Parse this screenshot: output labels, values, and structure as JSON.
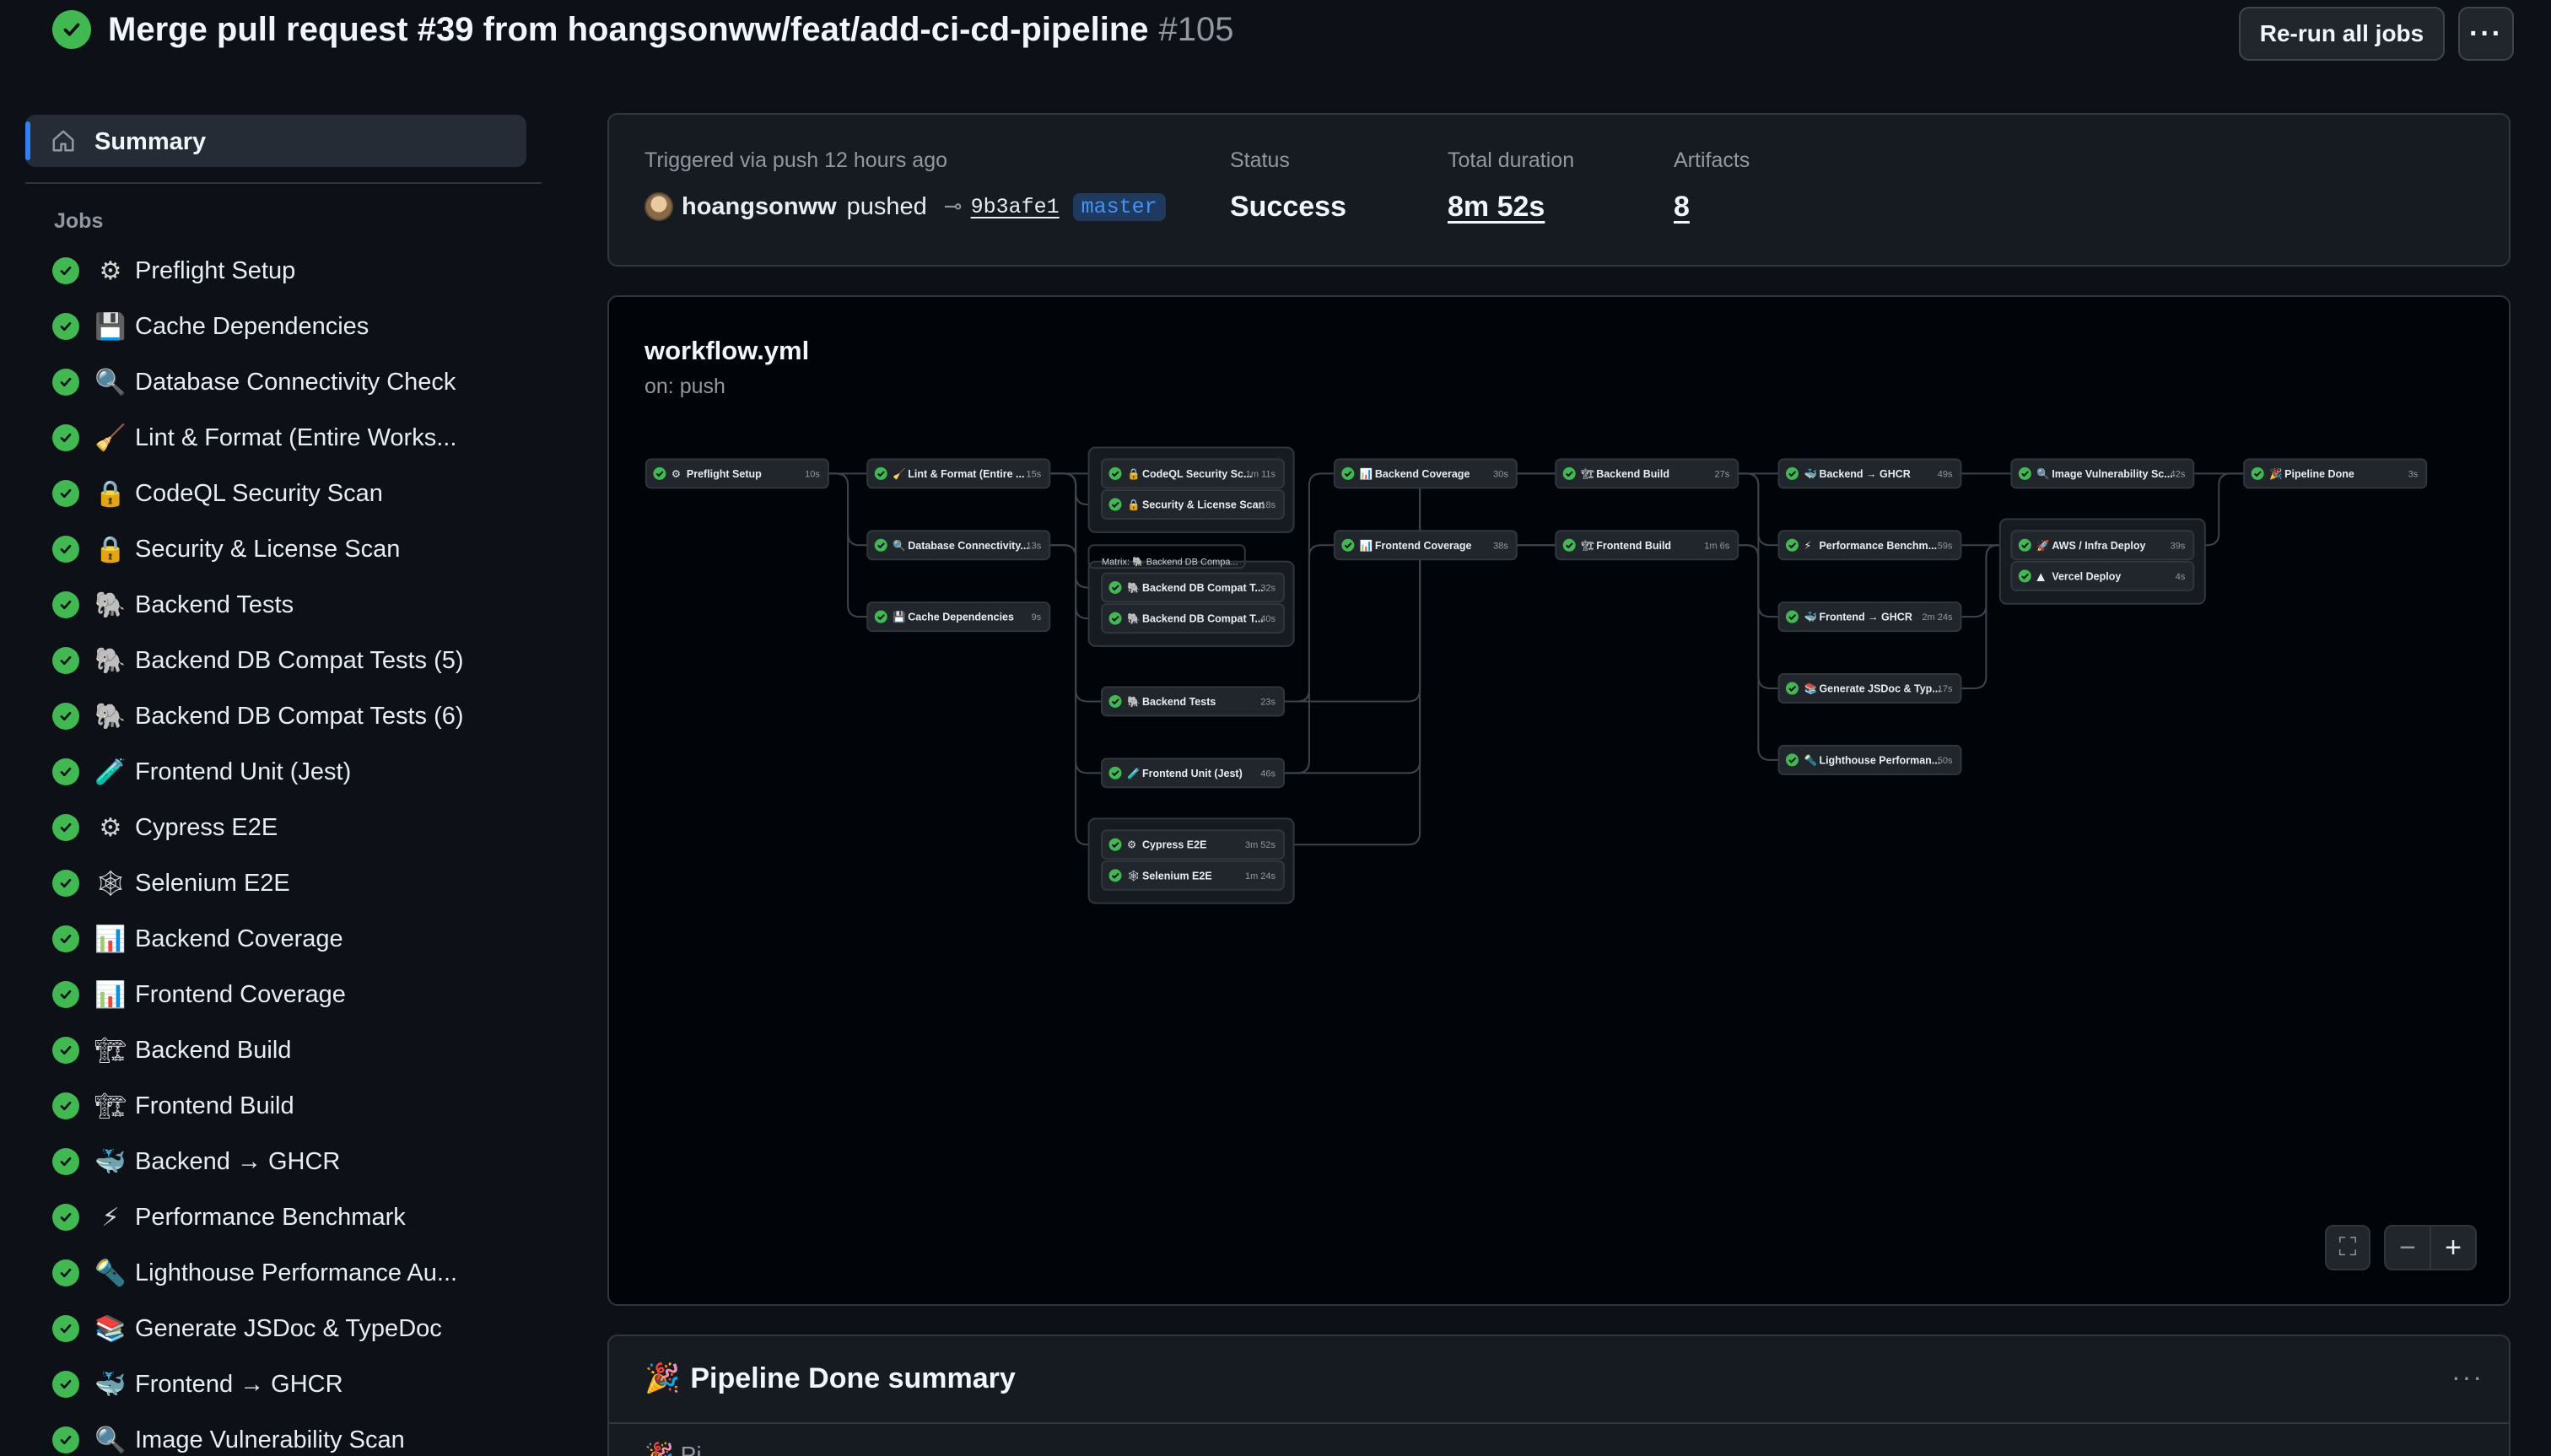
{
  "header": {
    "title": "Merge pull request #39 from hoangsonww/feat/add-ci-cd-pipeline",
    "run_number": "#105",
    "rerun_label": "Re-run all jobs",
    "more_label": "···"
  },
  "sidebar": {
    "summary_label": "Summary",
    "jobs_heading": "Jobs",
    "jobs": [
      {
        "emoji": "⚙",
        "name": "Preflight Setup"
      },
      {
        "emoji": "💾",
        "name": "Cache Dependencies"
      },
      {
        "emoji": "🔍",
        "name": "Database Connectivity Check"
      },
      {
        "emoji": "🧹",
        "name": "Lint & Format (Entire Works..."
      },
      {
        "emoji": "🔒",
        "name": "CodeQL Security Scan"
      },
      {
        "emoji": "🔒",
        "name": "Security & License Scan"
      },
      {
        "emoji": "🐘",
        "name": "Backend Tests"
      },
      {
        "emoji": "🐘",
        "name": "Backend DB Compat Tests (5)"
      },
      {
        "emoji": "🐘",
        "name": "Backend DB Compat Tests (6)"
      },
      {
        "emoji": "🧪",
        "name": "Frontend Unit (Jest)"
      },
      {
        "emoji": "⚙",
        "name": "Cypress E2E"
      },
      {
        "emoji": "🕸",
        "name": "Selenium E2E"
      },
      {
        "emoji": "📊",
        "name": "Backend Coverage"
      },
      {
        "emoji": "📊",
        "name": "Frontend Coverage"
      },
      {
        "emoji": "🏗",
        "name": "Backend Build"
      },
      {
        "emoji": "🏗",
        "name": "Frontend Build"
      },
      {
        "emoji": "🐳",
        "name": "Backend → GHCR"
      },
      {
        "emoji": "⚡",
        "name": "Performance Benchmark"
      },
      {
        "emoji": "🔦",
        "name": "Lighthouse Performance Au..."
      },
      {
        "emoji": "📚",
        "name": "Generate JSDoc & TypeDoc"
      },
      {
        "emoji": "🐳",
        "name": "Frontend → GHCR"
      },
      {
        "emoji": "🔍",
        "name": "Image Vulnerability Scan"
      }
    ]
  },
  "summary": {
    "trigger_text": "Triggered via push 12 hours ago",
    "user": "hoangsonww",
    "action": "pushed",
    "commit_icon": "⊸",
    "sha": "9b3afe1",
    "branch": "master",
    "status_label": "Status",
    "status_value": "Success",
    "duration_label": "Total duration",
    "duration_value": "8m 52s",
    "artifacts_label": "Artifacts",
    "artifacts_value": "8"
  },
  "workflow": {
    "title": "workflow.yml",
    "trigger": "on: push",
    "nodes": [
      {
        "id": "preflight",
        "emoji": "⚙",
        "label": "Preflight Setup",
        "dur": "10s"
      },
      {
        "id": "lint",
        "emoji": "🧹",
        "label": "Lint & Format (Entire ...",
        "dur": "15s"
      },
      {
        "id": "dbconn",
        "emoji": "🔍",
        "label": "Database Connectivity...",
        "dur": "13s"
      },
      {
        "id": "cache",
        "emoji": "💾",
        "label": "Cache Dependencies",
        "dur": "9s"
      },
      {
        "id": "codeql",
        "emoji": "🔒",
        "label": "CodeQL Security Sc...",
        "dur": "1m 11s"
      },
      {
        "id": "seclic",
        "emoji": "🔒",
        "label": "Security & License Scan",
        "dur": "18s"
      },
      {
        "id": "dbc1",
        "emoji": "🐘",
        "label": "Backend DB Compat T...",
        "dur": "32s"
      },
      {
        "id": "dbc2",
        "emoji": "🐘",
        "label": "Backend DB Compat T...",
        "dur": "40s"
      },
      {
        "id": "btests",
        "emoji": "🐘",
        "label": "Backend Tests",
        "dur": "23s"
      },
      {
        "id": "funit",
        "emoji": "🧪",
        "label": "Frontend Unit (Jest)",
        "dur": "46s"
      },
      {
        "id": "cypress",
        "emoji": "⚙",
        "label": "Cypress E2E",
        "dur": "3m 52s"
      },
      {
        "id": "selenium",
        "emoji": "🕸",
        "label": "Selenium E2E",
        "dur": "1m 24s"
      },
      {
        "id": "bcov",
        "emoji": "📊",
        "label": "Backend Coverage",
        "dur": "30s"
      },
      {
        "id": "fcov",
        "emoji": "📊",
        "label": "Frontend Coverage",
        "dur": "38s"
      },
      {
        "id": "bbuild",
        "emoji": "🏗",
        "label": "Backend Build",
        "dur": "27s"
      },
      {
        "id": "fbuild",
        "emoji": "🏗",
        "label": "Frontend Build",
        "dur": "1m 6s"
      },
      {
        "id": "bghcr",
        "emoji": "🐳",
        "label": "Backend → GHCR",
        "dur": "49s"
      },
      {
        "id": "perf",
        "emoji": "⚡",
        "label": "Performance Benchm...",
        "dur": "59s"
      },
      {
        "id": "fghcr",
        "emoji": "🐳",
        "label": "Frontend → GHCR",
        "dur": "2m 24s"
      },
      {
        "id": "jsdoc",
        "emoji": "📚",
        "label": "Generate JSDoc & Typ...",
        "dur": "17s"
      },
      {
        "id": "lighthouse",
        "emoji": "🔦",
        "label": "Lighthouse Performan...",
        "dur": "50s"
      },
      {
        "id": "imgvuln",
        "emoji": "🔍",
        "label": "Image Vulnerability Sc...",
        "dur": "42s"
      },
      {
        "id": "aws",
        "emoji": "🚀",
        "label": "AWS / Infra Deploy",
        "dur": "39s"
      },
      {
        "id": "vercel",
        "emoji": "▲",
        "label": "Vercel Deploy",
        "dur": "4s"
      },
      {
        "id": "done",
        "emoji": "🎉",
        "label": "Pipeline Done",
        "dur": "3s"
      }
    ],
    "matrix_label": "Matrix: 🐘 Backend DB Compa...",
    "controls": {
      "fullscreen": "⛶",
      "zoom_out": "−",
      "zoom_in": "+"
    }
  },
  "pipeline_done": {
    "emoji": "🎉",
    "title": "Pipeline Done summary",
    "more_label": "···",
    "peek": "🎉 Pi"
  },
  "colors": {
    "success": "#3fb950",
    "accent": "#2f81f7",
    "branch": "#4493f8"
  }
}
